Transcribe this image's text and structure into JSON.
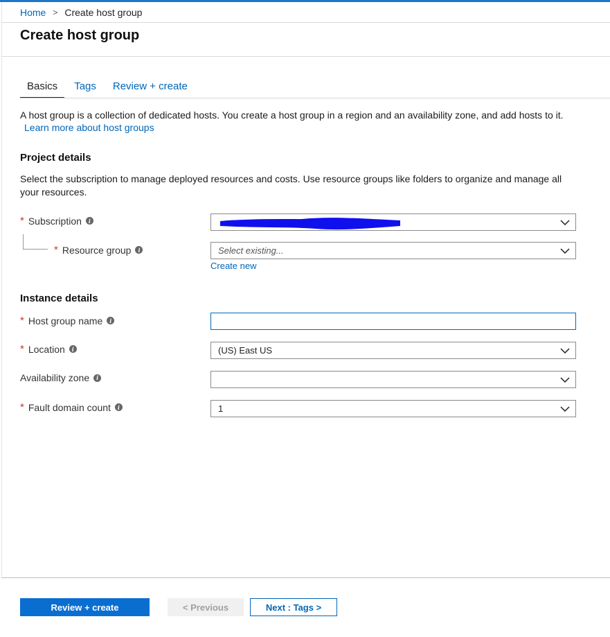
{
  "breadcrumb": {
    "home": "Home",
    "separator": ">",
    "current": "Create host group"
  },
  "page": {
    "title": "Create host group"
  },
  "tabs": [
    {
      "label": "Basics",
      "active": true
    },
    {
      "label": "Tags",
      "active": false
    },
    {
      "label": "Review + create",
      "active": false
    }
  ],
  "intro": {
    "text": "A host group is a collection of dedicated hosts. You create a host group in a region and an availability zone, and add hosts to it.",
    "link": "Learn more about host groups"
  },
  "project": {
    "title": "Project details",
    "description": "Select the subscription to manage deployed resources and costs. Use resource groups like folders to organize and manage all your resources.",
    "subscription": {
      "label": "Subscription",
      "required": true,
      "value": ""
    },
    "resource_group": {
      "label": "Resource group",
      "required": true,
      "placeholder": "Select existing...",
      "create_new": "Create new"
    }
  },
  "instance": {
    "title": "Instance details",
    "host_group_name": {
      "label": "Host group name",
      "required": true,
      "value": ""
    },
    "location": {
      "label": "Location",
      "required": true,
      "value": "(US) East US"
    },
    "availability_zone": {
      "label": "Availability zone",
      "required": false,
      "value": ""
    },
    "fault_domain_count": {
      "label": "Fault domain count",
      "required": true,
      "value": "1"
    }
  },
  "footer": {
    "review_create": "Review + create",
    "previous": "< Previous",
    "next": "Next : Tags >"
  },
  "colors": {
    "accent": "#0a6ed1",
    "link": "#0066b8",
    "required": "#c0392b",
    "redaction": "#1010ee"
  },
  "icons": {
    "info": "info-icon",
    "chevron": "chevron-down-icon",
    "breadcrumb_sep": "chevron-right-icon"
  }
}
